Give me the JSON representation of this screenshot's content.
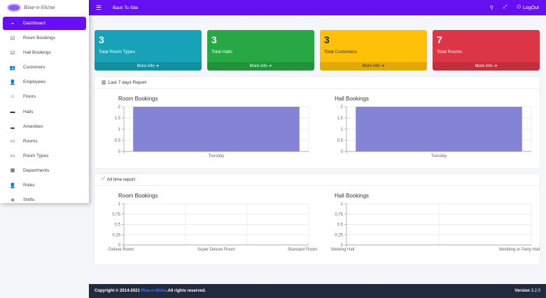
{
  "brand": {
    "name": "Rise-n-Shine"
  },
  "sidebar": {
    "items": [
      {
        "label": "Dashboard",
        "icon": "◒",
        "active": true
      },
      {
        "label": "Room Bookings",
        "icon": "☑"
      },
      {
        "label": "Hall Bookings",
        "icon": "☑"
      },
      {
        "label": "Customers",
        "icon": "👥"
      },
      {
        "label": "Employees",
        "icon": "👤"
      },
      {
        "label": "Floors",
        "icon": "⌂"
      },
      {
        "label": "Halls",
        "icon": "▬"
      },
      {
        "label": "Amenities",
        "icon": "▂"
      },
      {
        "label": "Rooms",
        "icon": "▭"
      },
      {
        "label": "Room Types",
        "icon": "▭"
      },
      {
        "label": "Departments",
        "icon": "▦"
      },
      {
        "label": "Roles",
        "icon": "👤"
      },
      {
        "label": "Shifts",
        "icon": "✲"
      }
    ]
  },
  "topbar": {
    "back_label": "Back To Site",
    "logout_label": "LogOut"
  },
  "stats": [
    {
      "value": "3",
      "label": "Total Room Types",
      "link": "More info",
      "color": "#17a2b8"
    },
    {
      "value": "3",
      "label": "Total Halls",
      "link": "More info",
      "color": "#28a745"
    },
    {
      "value": "3",
      "label": "Total Customers",
      "link": "More info",
      "color": "#ffc107"
    },
    {
      "value": "7",
      "label": "Total Rooms",
      "link": "More info",
      "color": "#dc3545"
    }
  ],
  "report7": {
    "title": "Last 7 days Report"
  },
  "reportAll": {
    "title": "All time report"
  },
  "chart_data": [
    {
      "type": "bar",
      "title": "Room Bookings",
      "categories": [
        "Tuesday"
      ],
      "values": [
        2
      ],
      "ylim": [
        0,
        2
      ],
      "yticks": [
        "0",
        "0.5",
        "1",
        "1.5",
        "2"
      ],
      "color": "#8583d6"
    },
    {
      "type": "bar",
      "title": "Hall Bookings",
      "categories": [
        "Tuesday"
      ],
      "values": [
        2
      ],
      "ylim": [
        0,
        2
      ],
      "yticks": [
        "0",
        "0.5",
        "1",
        "1.5",
        "2"
      ],
      "color": "#8583d6"
    },
    {
      "type": "bar",
      "title": "Room Bookings",
      "categories": [
        "Deluxe Room",
        "Super Deluxe Room",
        "Standard Room"
      ],
      "values": [
        0,
        0,
        0
      ],
      "ylim": [
        0,
        1
      ],
      "yticks": [
        "0",
        "0.25",
        "0.5",
        "0.75",
        "1"
      ],
      "color": "#8583d6"
    },
    {
      "type": "bar",
      "title": "Hall Bookings",
      "categories": [
        "Meeting Hall",
        "Wedding or Party Hall"
      ],
      "values": [
        0,
        0
      ],
      "ylim": [
        0,
        1
      ],
      "yticks": [
        "0",
        "0.25",
        "0.5",
        "0.75",
        "1"
      ],
      "color": "#8583d6"
    }
  ],
  "footer": {
    "copyright_prefix": "Copyright © 2014-2021",
    "brand": "Rise-n-Shine",
    "suffix": ".All rights reserved.",
    "version_label": "Version",
    "version": "3.2.0"
  }
}
